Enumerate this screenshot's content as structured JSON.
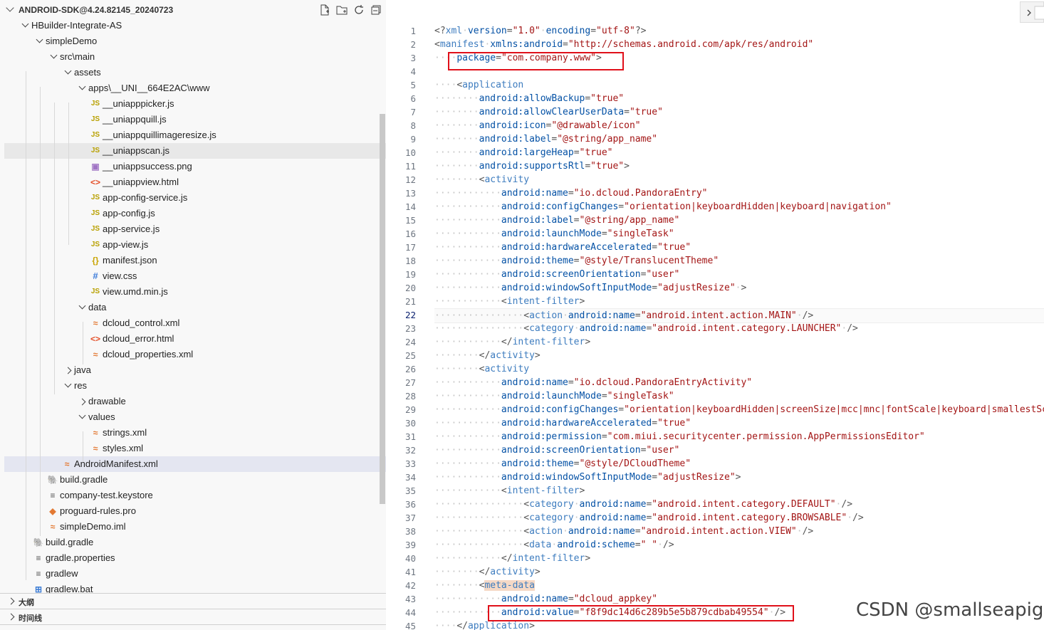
{
  "explorer": {
    "root_title": "ANDROID-SDK@4.24.82145_20240723",
    "items": [
      {
        "label": "HBuilder-Integrate-AS",
        "icon": "folder",
        "open": true
      },
      {
        "label": "simpleDemo",
        "icon": "folder",
        "open": true
      },
      {
        "label": "src\\main",
        "icon": "folder",
        "open": true
      },
      {
        "label": "assets",
        "icon": "folder",
        "open": true
      },
      {
        "label": "apps\\__UNI__664E2AC\\www",
        "icon": "folder",
        "open": true
      },
      {
        "label": "__uniapppicker.js",
        "icon": "js"
      },
      {
        "label": "__uniappquill.js",
        "icon": "js"
      },
      {
        "label": "__uniappquillimageresize.js",
        "icon": "js"
      },
      {
        "label": "__uniappscan.js",
        "icon": "js"
      },
      {
        "label": "__uniappsuccess.png",
        "icon": "png"
      },
      {
        "label": "__uniappview.html",
        "icon": "html"
      },
      {
        "label": "app-config-service.js",
        "icon": "js"
      },
      {
        "label": "app-config.js",
        "icon": "js"
      },
      {
        "label": "app-service.js",
        "icon": "js"
      },
      {
        "label": "app-view.js",
        "icon": "js"
      },
      {
        "label": "manifest.json",
        "icon": "json"
      },
      {
        "label": "view.css",
        "icon": "css"
      },
      {
        "label": "view.umd.min.js",
        "icon": "js"
      },
      {
        "label": "data",
        "icon": "folder",
        "open": true
      },
      {
        "label": "dcloud_control.xml",
        "icon": "xml"
      },
      {
        "label": "dcloud_error.html",
        "icon": "html"
      },
      {
        "label": "dcloud_properties.xml",
        "icon": "xml"
      },
      {
        "label": "java",
        "icon": "folder",
        "open": false
      },
      {
        "label": "res",
        "icon": "folder",
        "open": true
      },
      {
        "label": "drawable",
        "icon": "folder",
        "open": false
      },
      {
        "label": "values",
        "icon": "folder",
        "open": true
      },
      {
        "label": "strings.xml",
        "icon": "xml"
      },
      {
        "label": "styles.xml",
        "icon": "xml"
      },
      {
        "label": "AndroidManifest.xml",
        "icon": "xml"
      },
      {
        "label": "build.gradle",
        "icon": "gradle"
      },
      {
        "label": "company-test.keystore",
        "icon": "keystore"
      },
      {
        "label": "proguard-rules.pro",
        "icon": "pro"
      },
      {
        "label": "simpleDemo.iml",
        "icon": "xml"
      },
      {
        "label": "build.gradle",
        "icon": "gradle"
      },
      {
        "label": "gradle.properties",
        "icon": "props"
      },
      {
        "label": "gradlew",
        "icon": "props"
      },
      {
        "label": "gradlew.bat",
        "icon": "bat"
      }
    ],
    "panels": [
      {
        "label": "大纲"
      },
      {
        "label": "时间线"
      }
    ]
  },
  "editor": {
    "active_line": 22,
    "lines": [
      {
        "n": "1",
        "indent": 0,
        "tokens": [
          [
            "p",
            "<?"
          ],
          [
            "t",
            "xml"
          ],
          [
            "s",
            " "
          ],
          [
            "a",
            "version"
          ],
          [
            "p",
            "="
          ],
          [
            "v",
            "\"1.0\""
          ],
          [
            "s",
            " "
          ],
          [
            "a",
            "encoding"
          ],
          [
            "p",
            "="
          ],
          [
            "v",
            "\"utf-8\""
          ],
          [
            "p",
            "?>"
          ]
        ]
      },
      {
        "n": "2",
        "indent": 0,
        "tokens": [
          [
            "p",
            "<"
          ],
          [
            "t",
            "manifest"
          ],
          [
            "s",
            " "
          ],
          [
            "a",
            "xmlns:android"
          ],
          [
            "p",
            "="
          ],
          [
            "v",
            "\"http://schemas.android.com/apk/res/android\""
          ]
        ]
      },
      {
        "n": "3",
        "indent": 1,
        "tokens": [
          [
            "a",
            "package"
          ],
          [
            "p",
            "="
          ],
          [
            "v",
            "\"com.company.www\""
          ],
          [
            "p",
            ">"
          ]
        ]
      },
      {
        "n": "4",
        "indent": 0,
        "tokens": []
      },
      {
        "n": "5",
        "indent": 1,
        "tokens": [
          [
            "p",
            "<"
          ],
          [
            "t",
            "application"
          ]
        ]
      },
      {
        "n": "6",
        "indent": 2,
        "tokens": [
          [
            "a",
            "android:allowBackup"
          ],
          [
            "p",
            "="
          ],
          [
            "v",
            "\"true\""
          ]
        ]
      },
      {
        "n": "7",
        "indent": 2,
        "tokens": [
          [
            "a",
            "android:allowClearUserData"
          ],
          [
            "p",
            "="
          ],
          [
            "v",
            "\"true\""
          ]
        ]
      },
      {
        "n": "8",
        "indent": 2,
        "tokens": [
          [
            "a",
            "android:icon"
          ],
          [
            "p",
            "="
          ],
          [
            "v",
            "\"@drawable/icon\""
          ]
        ]
      },
      {
        "n": "9",
        "indent": 2,
        "tokens": [
          [
            "a",
            "android:label"
          ],
          [
            "p",
            "="
          ],
          [
            "v",
            "\"@string/app_name\""
          ]
        ]
      },
      {
        "n": "10",
        "indent": 2,
        "tokens": [
          [
            "a",
            "android:largeHeap"
          ],
          [
            "p",
            "="
          ],
          [
            "v",
            "\"true\""
          ]
        ]
      },
      {
        "n": "11",
        "indent": 2,
        "tokens": [
          [
            "a",
            "android:supportsRtl"
          ],
          [
            "p",
            "="
          ],
          [
            "v",
            "\"true\""
          ],
          [
            "p",
            ">"
          ]
        ]
      },
      {
        "n": "12",
        "indent": 2,
        "tokens": [
          [
            "p",
            "<"
          ],
          [
            "t",
            "activity"
          ]
        ]
      },
      {
        "n": "13",
        "indent": 3,
        "tokens": [
          [
            "a",
            "android:name"
          ],
          [
            "p",
            "="
          ],
          [
            "v",
            "\"io.dcloud.PandoraEntry\""
          ]
        ]
      },
      {
        "n": "14",
        "indent": 3,
        "tokens": [
          [
            "a",
            "android:configChanges"
          ],
          [
            "p",
            "="
          ],
          [
            "v",
            "\"orientation|keyboardHidden|keyboard|navigation\""
          ]
        ]
      },
      {
        "n": "15",
        "indent": 3,
        "tokens": [
          [
            "a",
            "android:label"
          ],
          [
            "p",
            "="
          ],
          [
            "v",
            "\"@string/app_name\""
          ]
        ]
      },
      {
        "n": "16",
        "indent": 3,
        "tokens": [
          [
            "a",
            "android:launchMode"
          ],
          [
            "p",
            "="
          ],
          [
            "v",
            "\"singleTask\""
          ]
        ]
      },
      {
        "n": "17",
        "indent": 3,
        "tokens": [
          [
            "a",
            "android:hardwareAccelerated"
          ],
          [
            "p",
            "="
          ],
          [
            "v",
            "\"true\""
          ]
        ]
      },
      {
        "n": "18",
        "indent": 3,
        "tokens": [
          [
            "a",
            "android:theme"
          ],
          [
            "p",
            "="
          ],
          [
            "v",
            "\"@style/TranslucentTheme\""
          ]
        ]
      },
      {
        "n": "19",
        "indent": 3,
        "tokens": [
          [
            "a",
            "android:screenOrientation"
          ],
          [
            "p",
            "="
          ],
          [
            "v",
            "\"user\""
          ]
        ]
      },
      {
        "n": "20",
        "indent": 3,
        "tokens": [
          [
            "a",
            "android:windowSoftInputMode"
          ],
          [
            "p",
            "="
          ],
          [
            "v",
            "\"adjustResize\""
          ],
          [
            "s",
            " "
          ],
          [
            "p",
            ">"
          ]
        ]
      },
      {
        "n": "21",
        "indent": 3,
        "tokens": [
          [
            "p",
            "<"
          ],
          [
            "t",
            "intent-filter"
          ],
          [
            "p",
            ">"
          ]
        ]
      },
      {
        "n": "22",
        "indent": 4,
        "tokens": [
          [
            "p",
            "<"
          ],
          [
            "t",
            "action"
          ],
          [
            "s",
            " "
          ],
          [
            "a",
            "android:name"
          ],
          [
            "p",
            "="
          ],
          [
            "v",
            "\"android.intent.action.MAIN\""
          ],
          [
            "s",
            " "
          ],
          [
            "p",
            "/>"
          ]
        ]
      },
      {
        "n": "23",
        "indent": 4,
        "tokens": [
          [
            "p",
            "<"
          ],
          [
            "t",
            "category"
          ],
          [
            "s",
            " "
          ],
          [
            "a",
            "android:name"
          ],
          [
            "p",
            "="
          ],
          [
            "v",
            "\"android.intent.category.LAUNCHER\""
          ],
          [
            "s",
            " "
          ],
          [
            "p",
            "/>"
          ]
        ]
      },
      {
        "n": "24",
        "indent": 3,
        "tokens": [
          [
            "p",
            "</"
          ],
          [
            "t",
            "intent-filter"
          ],
          [
            "p",
            ">"
          ]
        ]
      },
      {
        "n": "25",
        "indent": 2,
        "tokens": [
          [
            "p",
            "</"
          ],
          [
            "t",
            "activity"
          ],
          [
            "p",
            ">"
          ]
        ]
      },
      {
        "n": "26",
        "indent": 2,
        "tokens": [
          [
            "p",
            "<"
          ],
          [
            "t",
            "activity"
          ]
        ]
      },
      {
        "n": "27",
        "indent": 3,
        "tokens": [
          [
            "a",
            "android:name"
          ],
          [
            "p",
            "="
          ],
          [
            "v",
            "\"io.dcloud.PandoraEntryActivity\""
          ]
        ]
      },
      {
        "n": "28",
        "indent": 3,
        "tokens": [
          [
            "a",
            "android:launchMode"
          ],
          [
            "p",
            "="
          ],
          [
            "v",
            "\"singleTask\""
          ]
        ]
      },
      {
        "n": "29",
        "indent": 3,
        "tokens": [
          [
            "a",
            "android:configChanges"
          ],
          [
            "p",
            "="
          ],
          [
            "v",
            "\"orientation|keyboardHidden|screenSize|mcc|mnc|fontScale|keyboard|smallestScr"
          ]
        ]
      },
      {
        "n": "30",
        "indent": 3,
        "tokens": [
          [
            "a",
            "android:hardwareAccelerated"
          ],
          [
            "p",
            "="
          ],
          [
            "v",
            "\"true\""
          ]
        ]
      },
      {
        "n": "31",
        "indent": 3,
        "tokens": [
          [
            "a",
            "android:permission"
          ],
          [
            "p",
            "="
          ],
          [
            "v",
            "\"com.miui.securitycenter.permission.AppPermissionsEditor\""
          ]
        ]
      },
      {
        "n": "32",
        "indent": 3,
        "tokens": [
          [
            "a",
            "android:screenOrientation"
          ],
          [
            "p",
            "="
          ],
          [
            "v",
            "\"user\""
          ]
        ]
      },
      {
        "n": "33",
        "indent": 3,
        "tokens": [
          [
            "a",
            "android:theme"
          ],
          [
            "p",
            "="
          ],
          [
            "v",
            "\"@style/DCloudTheme\""
          ]
        ]
      },
      {
        "n": "34",
        "indent": 3,
        "tokens": [
          [
            "a",
            "android:windowSoftInputMode"
          ],
          [
            "p",
            "="
          ],
          [
            "v",
            "\"adjustResize\""
          ],
          [
            "p",
            ">"
          ]
        ]
      },
      {
        "n": "35",
        "indent": 3,
        "tokens": [
          [
            "p",
            "<"
          ],
          [
            "t",
            "intent-filter"
          ],
          [
            "p",
            ">"
          ]
        ]
      },
      {
        "n": "36",
        "indent": 4,
        "tokens": [
          [
            "p",
            "<"
          ],
          [
            "t",
            "category"
          ],
          [
            "s",
            " "
          ],
          [
            "a",
            "android:name"
          ],
          [
            "p",
            "="
          ],
          [
            "v",
            "\"android.intent.category.DEFAULT\""
          ],
          [
            "s",
            " "
          ],
          [
            "p",
            "/>"
          ]
        ]
      },
      {
        "n": "37",
        "indent": 4,
        "tokens": [
          [
            "p",
            "<"
          ],
          [
            "t",
            "category"
          ],
          [
            "s",
            " "
          ],
          [
            "a",
            "android:name"
          ],
          [
            "p",
            "="
          ],
          [
            "v",
            "\"android.intent.category.BROWSABLE\""
          ],
          [
            "s",
            " "
          ],
          [
            "p",
            "/>"
          ]
        ]
      },
      {
        "n": "38",
        "indent": 4,
        "tokens": [
          [
            "p",
            "<"
          ],
          [
            "t",
            "action"
          ],
          [
            "s",
            " "
          ],
          [
            "a",
            "android:name"
          ],
          [
            "p",
            "="
          ],
          [
            "v",
            "\"android.intent.action.VIEW\""
          ],
          [
            "s",
            " "
          ],
          [
            "p",
            "/>"
          ]
        ]
      },
      {
        "n": "39",
        "indent": 4,
        "tokens": [
          [
            "p",
            "<"
          ],
          [
            "t",
            "data"
          ],
          [
            "s",
            " "
          ],
          [
            "a",
            "android:scheme"
          ],
          [
            "p",
            "="
          ],
          [
            "v",
            "\" \""
          ],
          [
            "s",
            " "
          ],
          [
            "p",
            "/>"
          ]
        ]
      },
      {
        "n": "40",
        "indent": 3,
        "tokens": [
          [
            "p",
            "</"
          ],
          [
            "t",
            "intent-filter"
          ],
          [
            "p",
            ">"
          ]
        ]
      },
      {
        "n": "41",
        "indent": 2,
        "tokens": [
          [
            "p",
            "</"
          ],
          [
            "t",
            "activity"
          ],
          [
            "p",
            ">"
          ]
        ]
      },
      {
        "n": "42",
        "indent": 2,
        "tokens": [
          [
            "p",
            "<"
          ],
          [
            "h",
            "meta-data"
          ]
        ]
      },
      {
        "n": "43",
        "indent": 3,
        "tokens": [
          [
            "a",
            "android:name"
          ],
          [
            "p",
            "="
          ],
          [
            "v",
            "\"dcloud_appkey\""
          ]
        ]
      },
      {
        "n": "44",
        "indent": 3,
        "tokens": [
          [
            "a",
            "android:value"
          ],
          [
            "p",
            "="
          ],
          [
            "v",
            "\"f8f9dc14d6c289b5e5b879cdbab49554\""
          ],
          [
            "s",
            " "
          ],
          [
            "p",
            "/>"
          ]
        ]
      },
      {
        "n": "45",
        "indent": 1,
        "tokens": [
          [
            "p",
            "</"
          ],
          [
            "t",
            "application"
          ],
          [
            "p",
            ">"
          ]
        ]
      }
    ]
  },
  "watermark": "CSDN @smallseapig",
  "colors": {
    "highlight_box": "#e0101a",
    "tag": "#3d7cbf",
    "attribute": "#0451a5",
    "value": "#a31515"
  },
  "icons": {
    "new_file": "new-file-icon",
    "new_folder": "new-folder-icon",
    "refresh": "refresh-icon",
    "collapse": "collapse-all-icon"
  }
}
